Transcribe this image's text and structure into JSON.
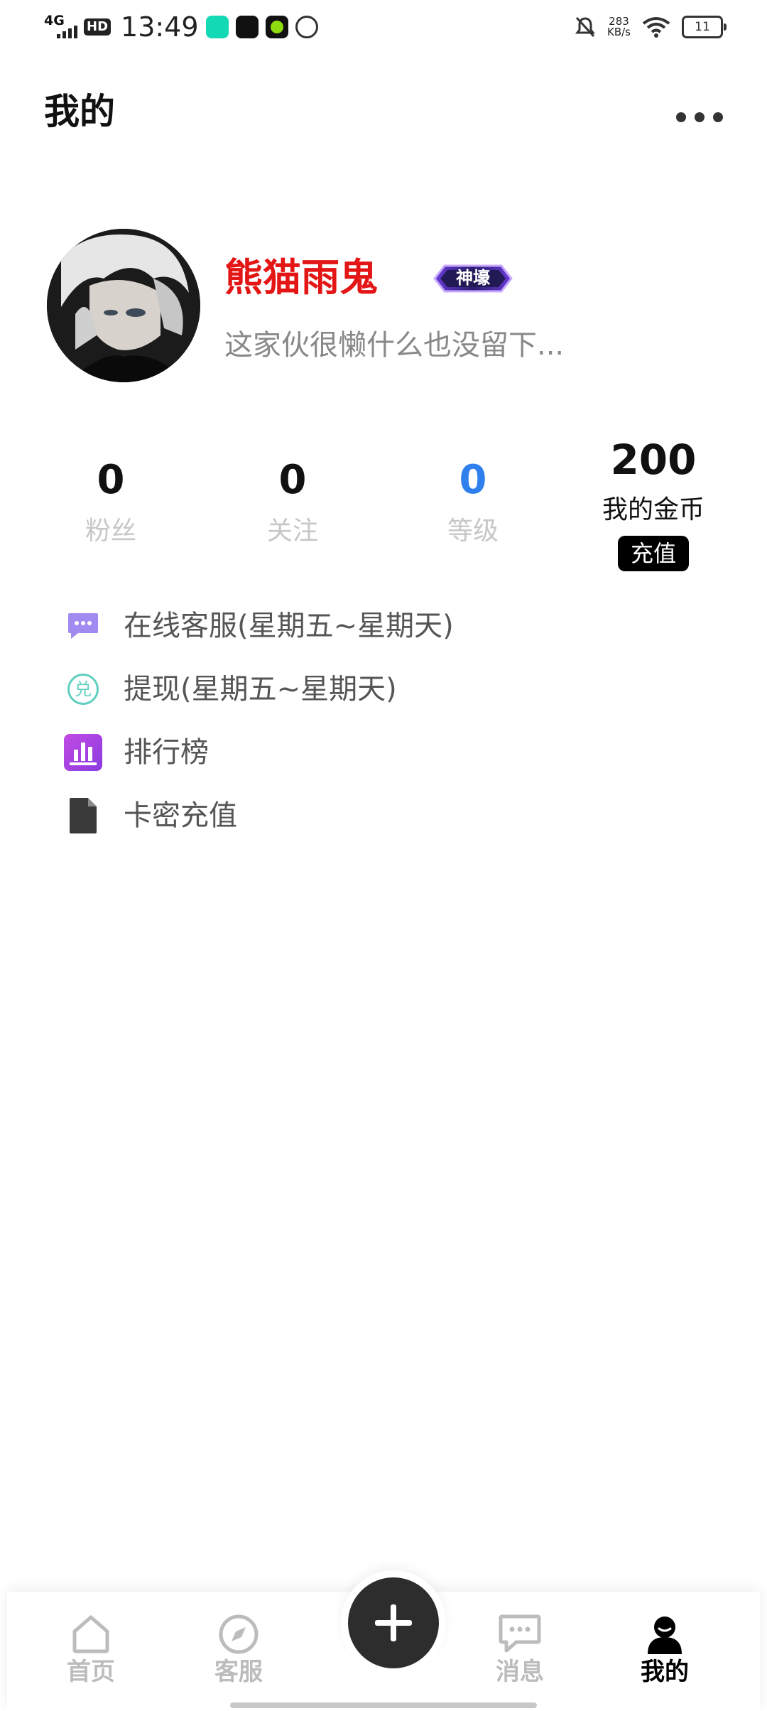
{
  "status_bar": {
    "network": "4G",
    "hd": "HD",
    "time": "13:49",
    "speed_value": "283",
    "speed_unit": "KB/s",
    "battery": "11"
  },
  "header": {
    "title": "我的"
  },
  "profile": {
    "username": "熊猫雨鬼",
    "badge": "神壕",
    "bio": "这家伙很懒什么也没留下..."
  },
  "stats": [
    {
      "value": "0",
      "label": "粉丝"
    },
    {
      "value": "0",
      "label": "关注"
    },
    {
      "value": "0",
      "label": "等级"
    }
  ],
  "coins": {
    "value": "200",
    "label": "我的金币",
    "recharge_label": "充值"
  },
  "menu": [
    {
      "label": "在线客服(星期五~星期天)",
      "icon": "chat-icon"
    },
    {
      "label": "提现(星期五~星期天)",
      "icon": "exchange-icon",
      "icon_text": "兑"
    },
    {
      "label": "排行榜",
      "icon": "ranking-icon"
    },
    {
      "label": "卡密充值",
      "icon": "document-icon"
    }
  ],
  "nav": [
    {
      "label": "首页",
      "icon": "home-icon"
    },
    {
      "label": "客服",
      "icon": "compass-icon"
    },
    {
      "label": "消息",
      "icon": "message-icon"
    },
    {
      "label": "我的",
      "icon": "profile-icon",
      "active": true
    }
  ],
  "colors": {
    "username": "#e31515",
    "level": "#2f80ed",
    "inactive_nav": "#bcbcbc"
  }
}
